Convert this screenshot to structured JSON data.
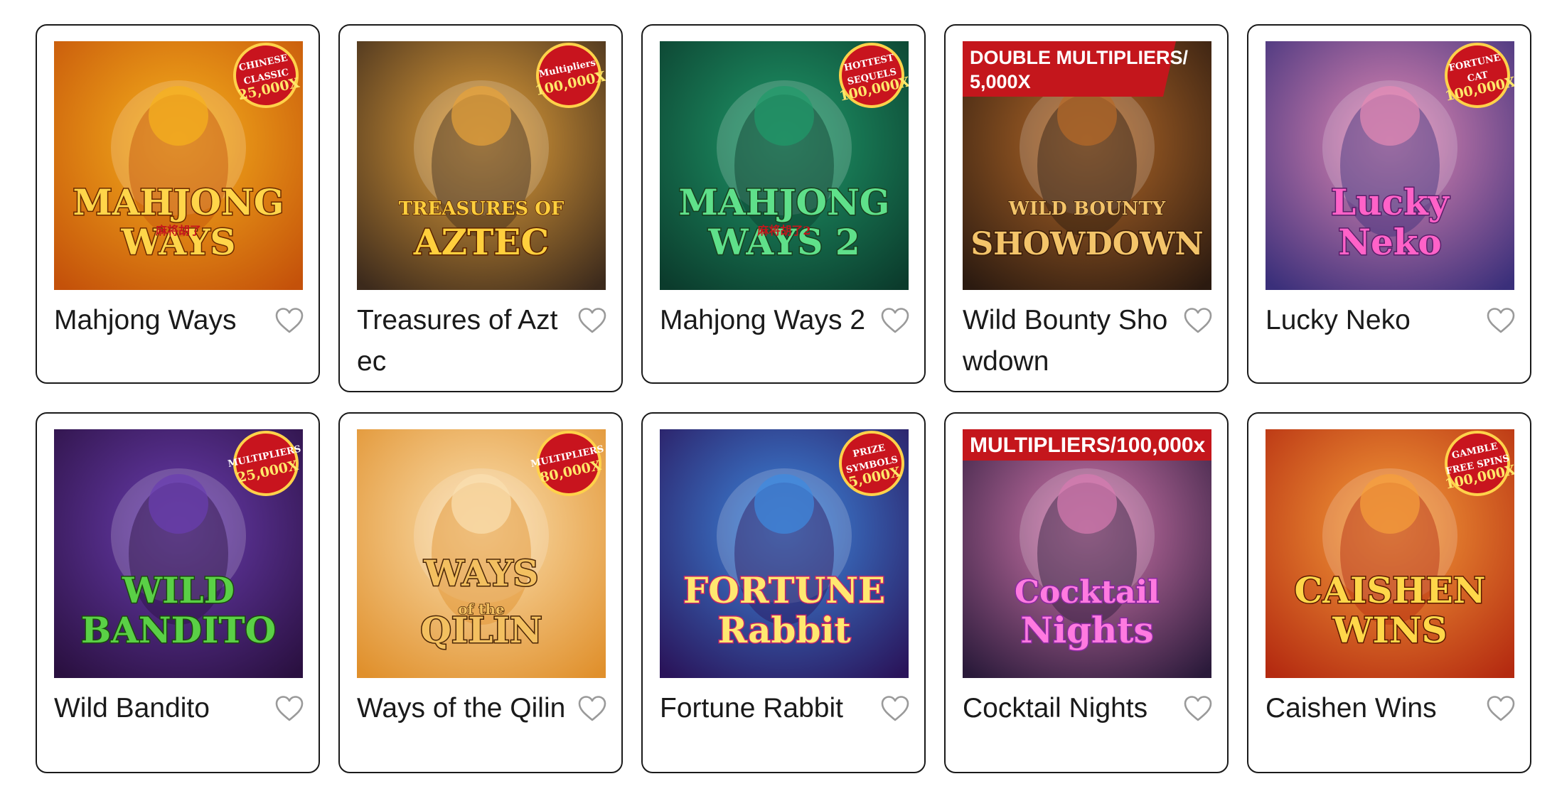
{
  "games": [
    {
      "title": "Mahjong Ways",
      "logo_lines": [
        "MAHJONG",
        "WAYS"
      ],
      "sub_logo": "麻将胡了",
      "badge": [
        "CHINESE",
        "CLASSIC",
        "25,000X"
      ],
      "banner": [],
      "colors": {
        "bg1": "#f6b21c",
        "bg2": "#c4510a",
        "logo": "#ffd54a",
        "logo_stroke": "#6a2a00"
      }
    },
    {
      "title": "Treasures of Aztec",
      "logo_lines": [
        "TREASURES OF",
        "AZTEC"
      ],
      "sub_logo": "",
      "badge": [
        "Multipliers",
        "100,000X"
      ],
      "banner": [],
      "colors": {
        "bg1": "#e7a33a",
        "bg2": "#3c2a1c",
        "logo": "#ffcf3d",
        "logo_stroke": "#5a2300"
      }
    },
    {
      "title": "Mahjong Ways 2",
      "logo_lines": [
        "MAHJONG",
        "WAYS 2"
      ],
      "sub_logo": "麻将胡了2",
      "badge": [
        "HOTTEST",
        "SEQUELS",
        "100,000X"
      ],
      "banner": [],
      "colors": {
        "bg1": "#1f9a6a",
        "bg2": "#0b3b2c",
        "logo": "#5fe08a",
        "logo_stroke": "#17401f"
      }
    },
    {
      "title": "Wild Bounty Showdown",
      "logo_lines": [
        "WILD BOUNTY",
        "SHOWDOWN"
      ],
      "sub_logo": "",
      "badge": [],
      "banner": [
        "DOUBLE MULTIPLIERS/",
        "5,000X"
      ],
      "colors": {
        "bg1": "#b66a28",
        "bg2": "#2b1a10",
        "logo": "#f3c46a",
        "logo_stroke": "#3a1c08"
      }
    },
    {
      "title": "Lucky Neko",
      "logo_lines": [
        "Lucky",
        "Neko"
      ],
      "sub_logo": "",
      "badge": [
        "FORTUNE",
        "CAT",
        "100,000X"
      ],
      "banner": [],
      "colors": {
        "bg1": "#e58ab5",
        "bg2": "#3a2f7a",
        "logo": "#ff62c8",
        "logo_stroke": "#5a1f6a"
      }
    },
    {
      "title": "Wild Bandito",
      "logo_lines": [
        "WILD",
        "BANDITO"
      ],
      "sub_logo": "",
      "badge": [
        "MULTIPLIERS",
        "25,000X"
      ],
      "banner": [],
      "colors": {
        "bg1": "#6a3db0",
        "bg2": "#2a1040",
        "logo": "#5ad046",
        "logo_stroke": "#1d4a10"
      }
    },
    {
      "title": "Ways of the Qilin",
      "logo_lines": [
        "WAYS",
        "of the",
        "QILIN"
      ],
      "sub_logo": "",
      "badge": [
        "MULTIPLIERS",
        "80,000X"
      ],
      "banner": [],
      "colors": {
        "bg1": "#fbe0b0",
        "bg2": "#e0902c",
        "logo": "#f3c060",
        "logo_stroke": "#4a2606"
      }
    },
    {
      "title": "Fortune Rabbit",
      "logo_lines": [
        "FORTUNE",
        "Rabbit"
      ],
      "sub_logo": "",
      "badge": [
        "PRIZE",
        "SYMBOLS",
        "5,000X"
      ],
      "banner": [],
      "colors": {
        "bg1": "#3d8ae0",
        "bg2": "#2a145a",
        "logo": "#ffe870",
        "logo_stroke": "#c2266a"
      }
    },
    {
      "title": "Cocktail Nights",
      "logo_lines": [
        "Cocktail",
        "Nights"
      ],
      "sub_logo": "",
      "badge": [],
      "banner": [
        "MULTIPLIERS/100,000x"
      ],
      "colors": {
        "bg1": "#d77ab0",
        "bg2": "#2a1a3a",
        "logo": "#ff7ae0",
        "logo_stroke": "#8a2aa0"
      }
    },
    {
      "title": "Caishen Wins",
      "logo_lines": [
        "CAISHEN",
        "WINS"
      ],
      "sub_logo": "",
      "badge": [
        "GAMBLE",
        "FREE SPINS",
        "100,000X"
      ],
      "banner": [],
      "colors": {
        "bg1": "#f6a03a",
        "bg2": "#b42a10",
        "logo": "#ffd74a",
        "logo_stroke": "#5a1a00"
      }
    }
  ],
  "icons": {
    "favorite": "heart-outline-icon"
  },
  "colors": {
    "card_border": "#1a1a1a",
    "heart": "#9a9a9a",
    "banner_red": "#c4161c",
    "badge_red": "#c8141e"
  }
}
